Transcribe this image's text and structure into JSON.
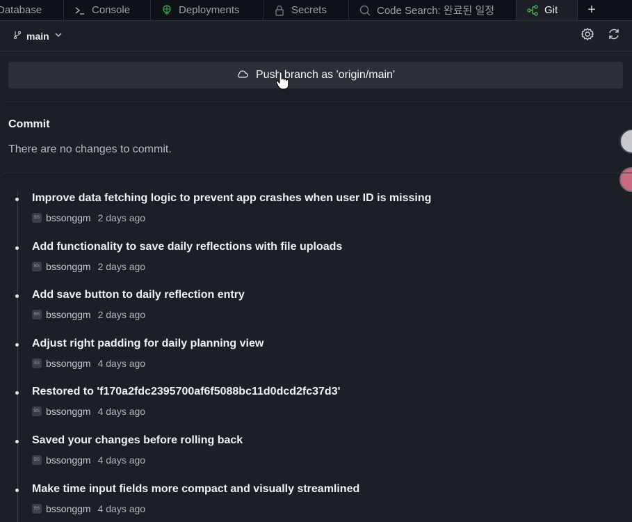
{
  "tabs": [
    {
      "label": "Database",
      "icon": "database-icon"
    },
    {
      "label": "Console",
      "icon": "console-icon"
    },
    {
      "label": "Deployments",
      "icon": "deployments-icon"
    },
    {
      "label": "Secrets",
      "icon": "lock-icon"
    },
    {
      "label": "Code Search: 완료된 일정",
      "icon": "search-icon"
    },
    {
      "label": "Git",
      "icon": "git-icon",
      "active": true
    },
    {
      "label": "+",
      "icon": "add-tab-icon"
    }
  ],
  "branch": {
    "name": "main"
  },
  "push": {
    "label": "Push branch as 'origin/main'"
  },
  "commit_section": {
    "title": "Commit",
    "empty_message": "There are no changes to commit."
  },
  "history": [
    {
      "message": "Improve data fetching logic to prevent app crashes when user ID is missing",
      "author": "bssonggm",
      "time": "2 days ago"
    },
    {
      "message": "Add functionality to save daily reflections with file uploads",
      "author": "bssonggm",
      "time": "2 days ago"
    },
    {
      "message": "Add save button to daily reflection entry",
      "author": "bssonggm",
      "time": "2 days ago"
    },
    {
      "message": "Adjust right padding for daily planning view",
      "author": "bssonggm",
      "time": "4 days ago"
    },
    {
      "message": "Restored to 'f170a2fdc2395700af6f5088bc11d0dcd2fc37d3'",
      "author": "bssonggm",
      "time": "4 days ago"
    },
    {
      "message": "Saved your changes before rolling back",
      "author": "bssonggm",
      "time": "4 days ago"
    },
    {
      "message": "Make time input fields more compact and visually streamlined",
      "author": "bssonggm",
      "time": "4 days ago"
    }
  ],
  "colors": {
    "background": "#1c1f26",
    "tabbar": "#0e1117",
    "push_button": "#2b3039",
    "git_accent": "#3fb950",
    "deploy_accent": "#2ea043"
  }
}
